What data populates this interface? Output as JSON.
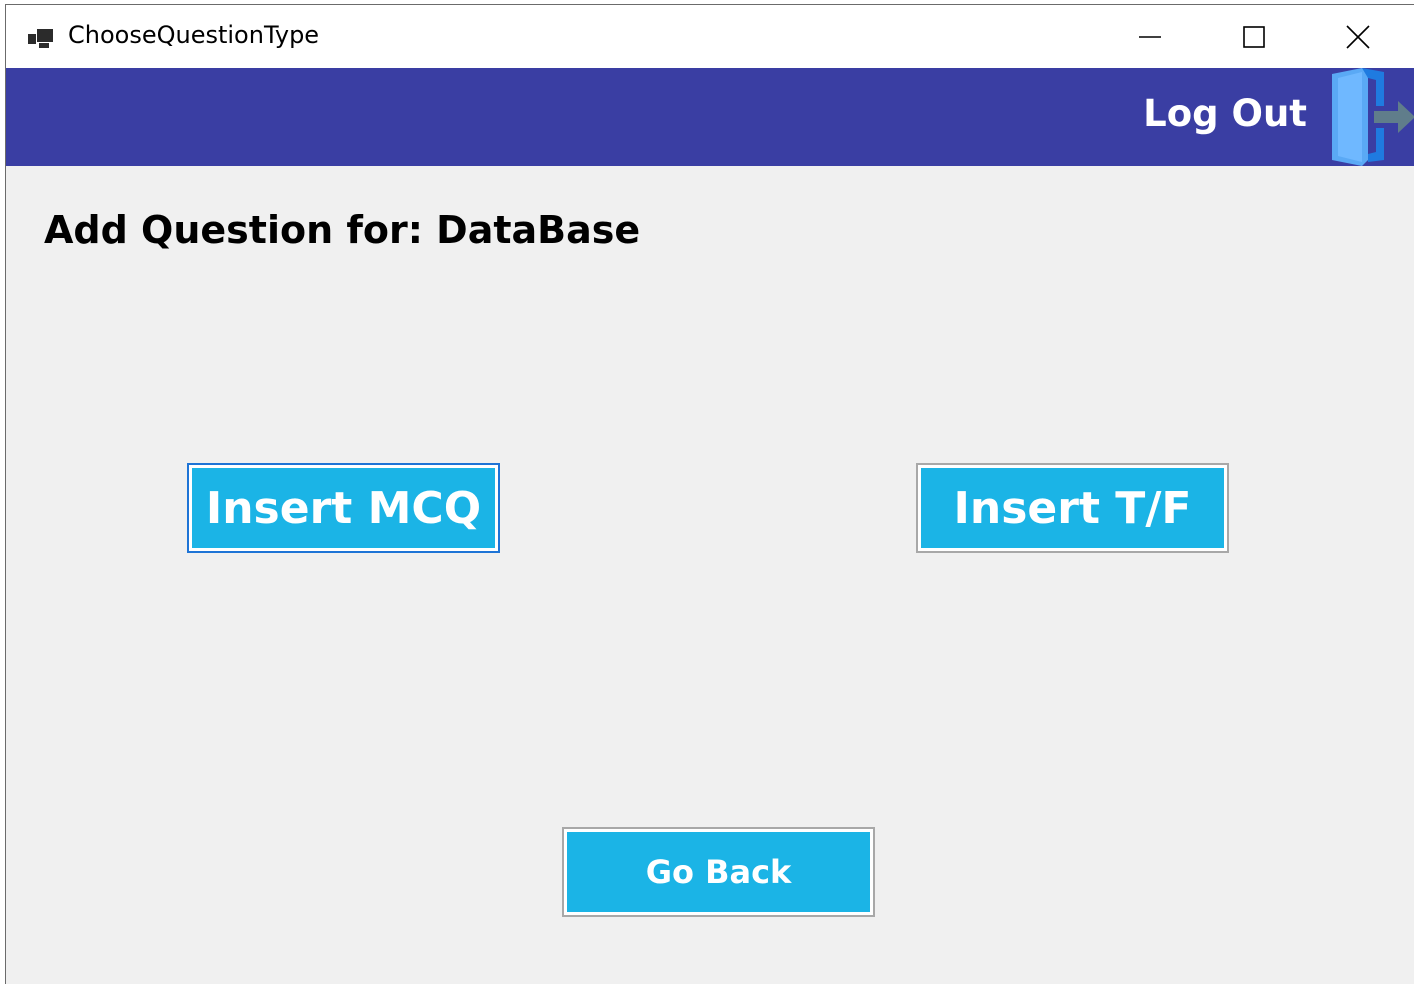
{
  "window": {
    "title": "ChooseQuestionType"
  },
  "header": {
    "logout_label": "Log Out",
    "logout_icon": "logout-door-arrow-icon",
    "background_color": "#3a3ea3"
  },
  "main": {
    "heading": "Add Question for: DataBase",
    "buttons": {
      "insert_mcq": "Insert MCQ",
      "insert_tf": "Insert T/F",
      "go_back": "Go Back"
    },
    "button_color": "#1bb4e6",
    "focused_button": "insert_mcq"
  },
  "icons": {
    "app": "app-window-icon",
    "minimize": "minimize-icon",
    "maximize": "maximize-icon",
    "close": "close-icon"
  }
}
